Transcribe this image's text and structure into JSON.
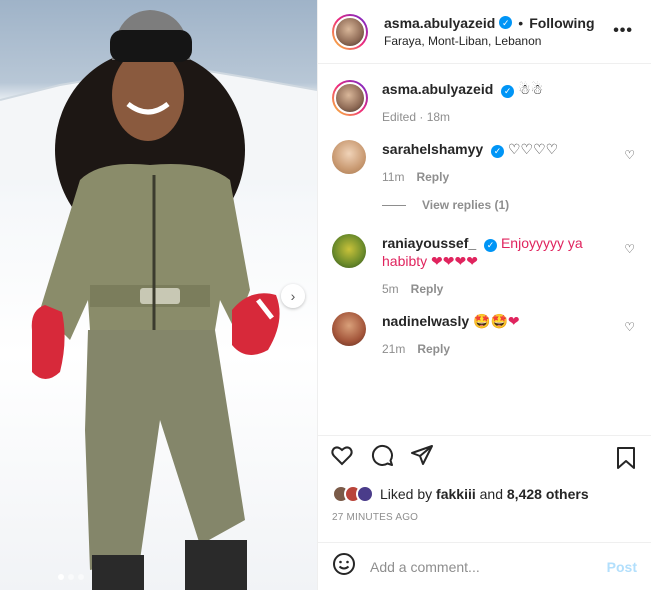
{
  "post": {
    "author": "asma.abulyazeid",
    "following_label": "Following",
    "location": "Faraya, Mont-Liban, Lebanon",
    "caption_emoji": "☃☃",
    "edited": "Edited · 18m"
  },
  "comments": [
    {
      "user": "sarahelshamyy",
      "verified": true,
      "text": "♡♡♡♡",
      "time": "11m",
      "reply": "Reply",
      "view_replies": "View replies (1)"
    },
    {
      "user": "raniayoussef_",
      "verified": true,
      "text": "Enjoyyyyy ya habibty ❤❤❤❤",
      "time": "5m",
      "reply": "Reply"
    },
    {
      "user": "nadinelwasly",
      "verified": false,
      "text": "🤩🤩❤",
      "time": "21m",
      "reply": "Reply"
    }
  ],
  "likes": {
    "prefix": "Liked by",
    "user": "fakkiii",
    "middle": "and",
    "count": "8,428 others"
  },
  "time_ago": "27 MINUTES AGO",
  "add_comment": {
    "placeholder": "Add a comment...",
    "post_label": "Post"
  },
  "icons": {
    "more": "more-options-icon",
    "like": "heart-icon",
    "comment": "comment-icon",
    "share": "share-icon",
    "save": "bookmark-icon",
    "emoji": "emoji-icon",
    "next": "chevron-right-icon"
  },
  "colors": {
    "verified": "#0095f6",
    "post_disabled": "#b2dffc",
    "secondary_text": "#8e8e8e"
  }
}
